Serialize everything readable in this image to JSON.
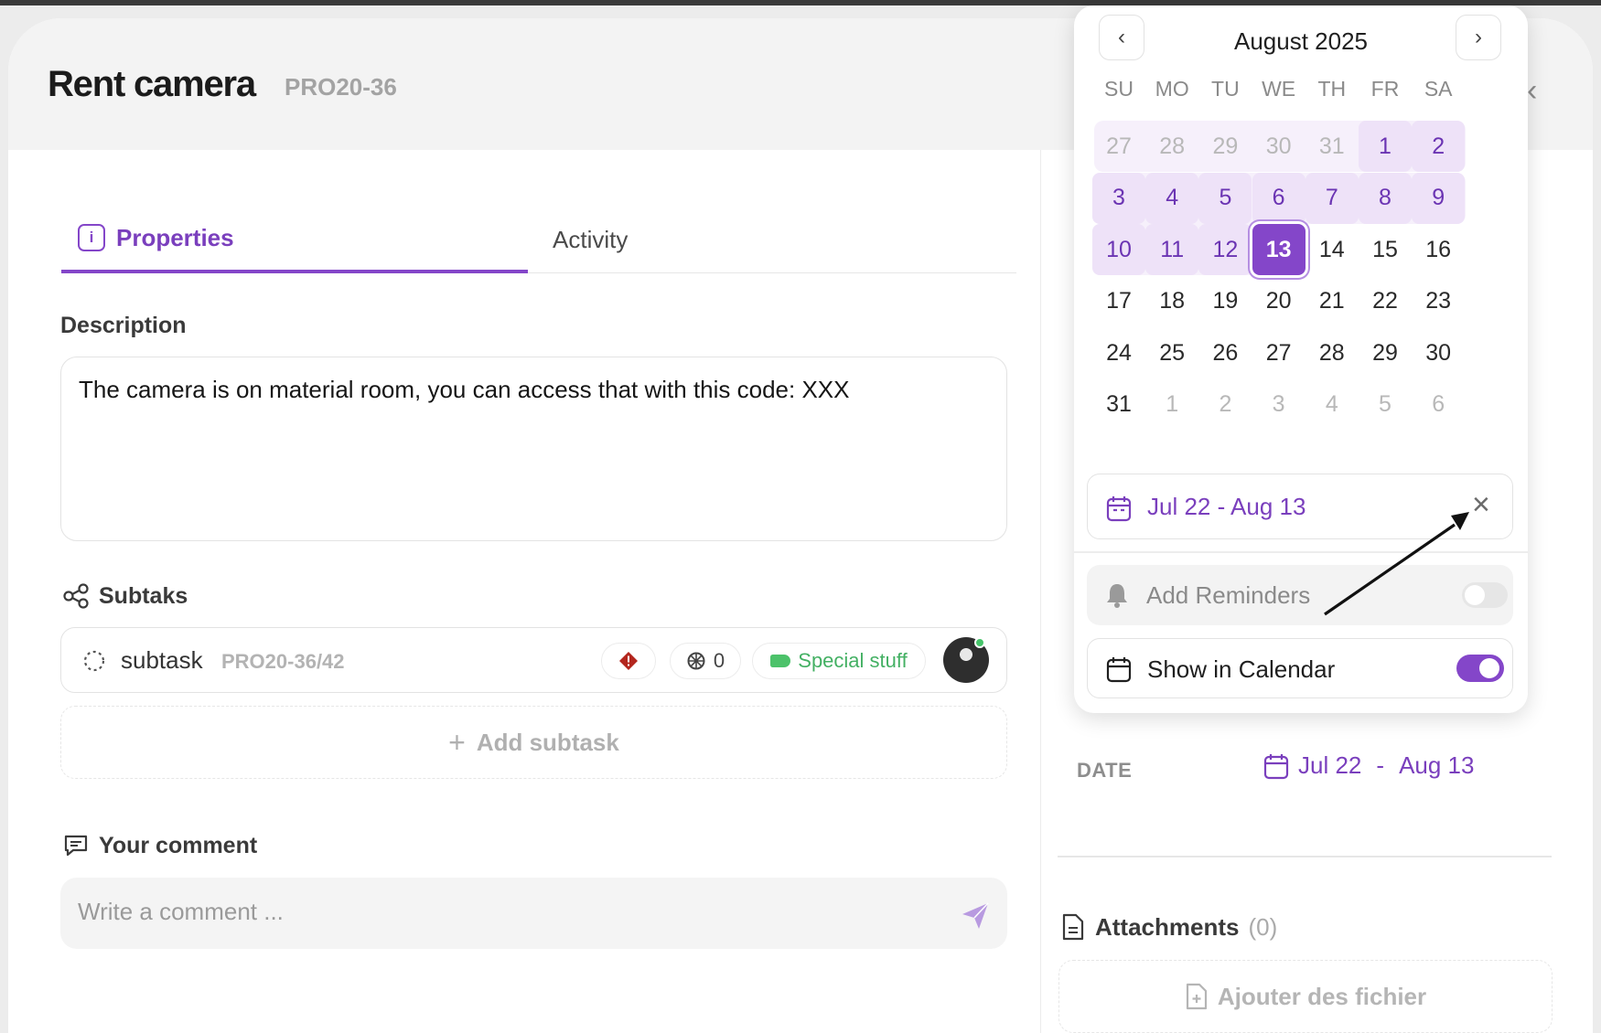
{
  "task": {
    "title": "Rent camera",
    "code": "PRO20-36"
  },
  "tabs": [
    {
      "label": "Properties"
    },
    {
      "label": "Activity"
    }
  ],
  "description": {
    "label": "Description",
    "text": "The camera is on material room, you can access that with this code: XXX"
  },
  "subtasks": {
    "label": "Subtaks",
    "items": [
      {
        "name": "subtask",
        "code": "PRO20-36/42",
        "points": "0",
        "tag": "Special stuff"
      }
    ],
    "add_label": "Add subtask"
  },
  "comment": {
    "label": "Your comment",
    "placeholder": "Write a comment ..."
  },
  "date": {
    "label": "DATE",
    "start": "Jul 22",
    "separator": "-",
    "end": "Aug 13"
  },
  "attachments": {
    "label": "Attachments",
    "count": "(0)",
    "add_label": "Ajouter des fichier"
  },
  "calendar": {
    "month": "August 2025",
    "weekdays": [
      "SU",
      "MO",
      "TU",
      "WE",
      "TH",
      "FR",
      "SA"
    ],
    "weeks": [
      [
        {
          "d": "27",
          "t": "other"
        },
        {
          "d": "28",
          "t": "other"
        },
        {
          "d": "29",
          "t": "other"
        },
        {
          "d": "30",
          "t": "other"
        },
        {
          "d": "31",
          "t": "other"
        },
        {
          "d": "1",
          "t": "range"
        },
        {
          "d": "2",
          "t": "range"
        }
      ],
      [
        {
          "d": "3",
          "t": "range"
        },
        {
          "d": "4",
          "t": "range"
        },
        {
          "d": "5",
          "t": "range"
        },
        {
          "d": "6",
          "t": "range"
        },
        {
          "d": "7",
          "t": "range"
        },
        {
          "d": "8",
          "t": "range"
        },
        {
          "d": "9",
          "t": "range"
        }
      ],
      [
        {
          "d": "10",
          "t": "range"
        },
        {
          "d": "11",
          "t": "range"
        },
        {
          "d": "12",
          "t": "range"
        },
        {
          "d": "13",
          "t": "selected"
        },
        {
          "d": "14",
          "t": "normal"
        },
        {
          "d": "15",
          "t": "normal"
        },
        {
          "d": "16",
          "t": "normal"
        }
      ],
      [
        {
          "d": "17",
          "t": "normal"
        },
        {
          "d": "18",
          "t": "normal"
        },
        {
          "d": "19",
          "t": "normal"
        },
        {
          "d": "20",
          "t": "normal"
        },
        {
          "d": "21",
          "t": "normal"
        },
        {
          "d": "22",
          "t": "normal"
        },
        {
          "d": "23",
          "t": "normal"
        }
      ],
      [
        {
          "d": "24",
          "t": "normal"
        },
        {
          "d": "25",
          "t": "normal"
        },
        {
          "d": "26",
          "t": "normal"
        },
        {
          "d": "27",
          "t": "normal"
        },
        {
          "d": "28",
          "t": "normal"
        },
        {
          "d": "29",
          "t": "normal"
        },
        {
          "d": "30",
          "t": "normal"
        }
      ],
      [
        {
          "d": "31",
          "t": "normal"
        },
        {
          "d": "1",
          "t": "other"
        },
        {
          "d": "2",
          "t": "other"
        },
        {
          "d": "3",
          "t": "other"
        },
        {
          "d": "4",
          "t": "other"
        },
        {
          "d": "5",
          "t": "other"
        },
        {
          "d": "6",
          "t": "other"
        }
      ]
    ],
    "range_text": "Jul 22 - Aug 13",
    "reminders_label": "Add Reminders",
    "reminders_on": false,
    "show_in_calendar_label": "Show in Calendar",
    "show_in_calendar_on": true
  },
  "colors": {
    "accent": "#8446c9",
    "tag_green": "#43b063",
    "priority_red": "#b3261e"
  }
}
